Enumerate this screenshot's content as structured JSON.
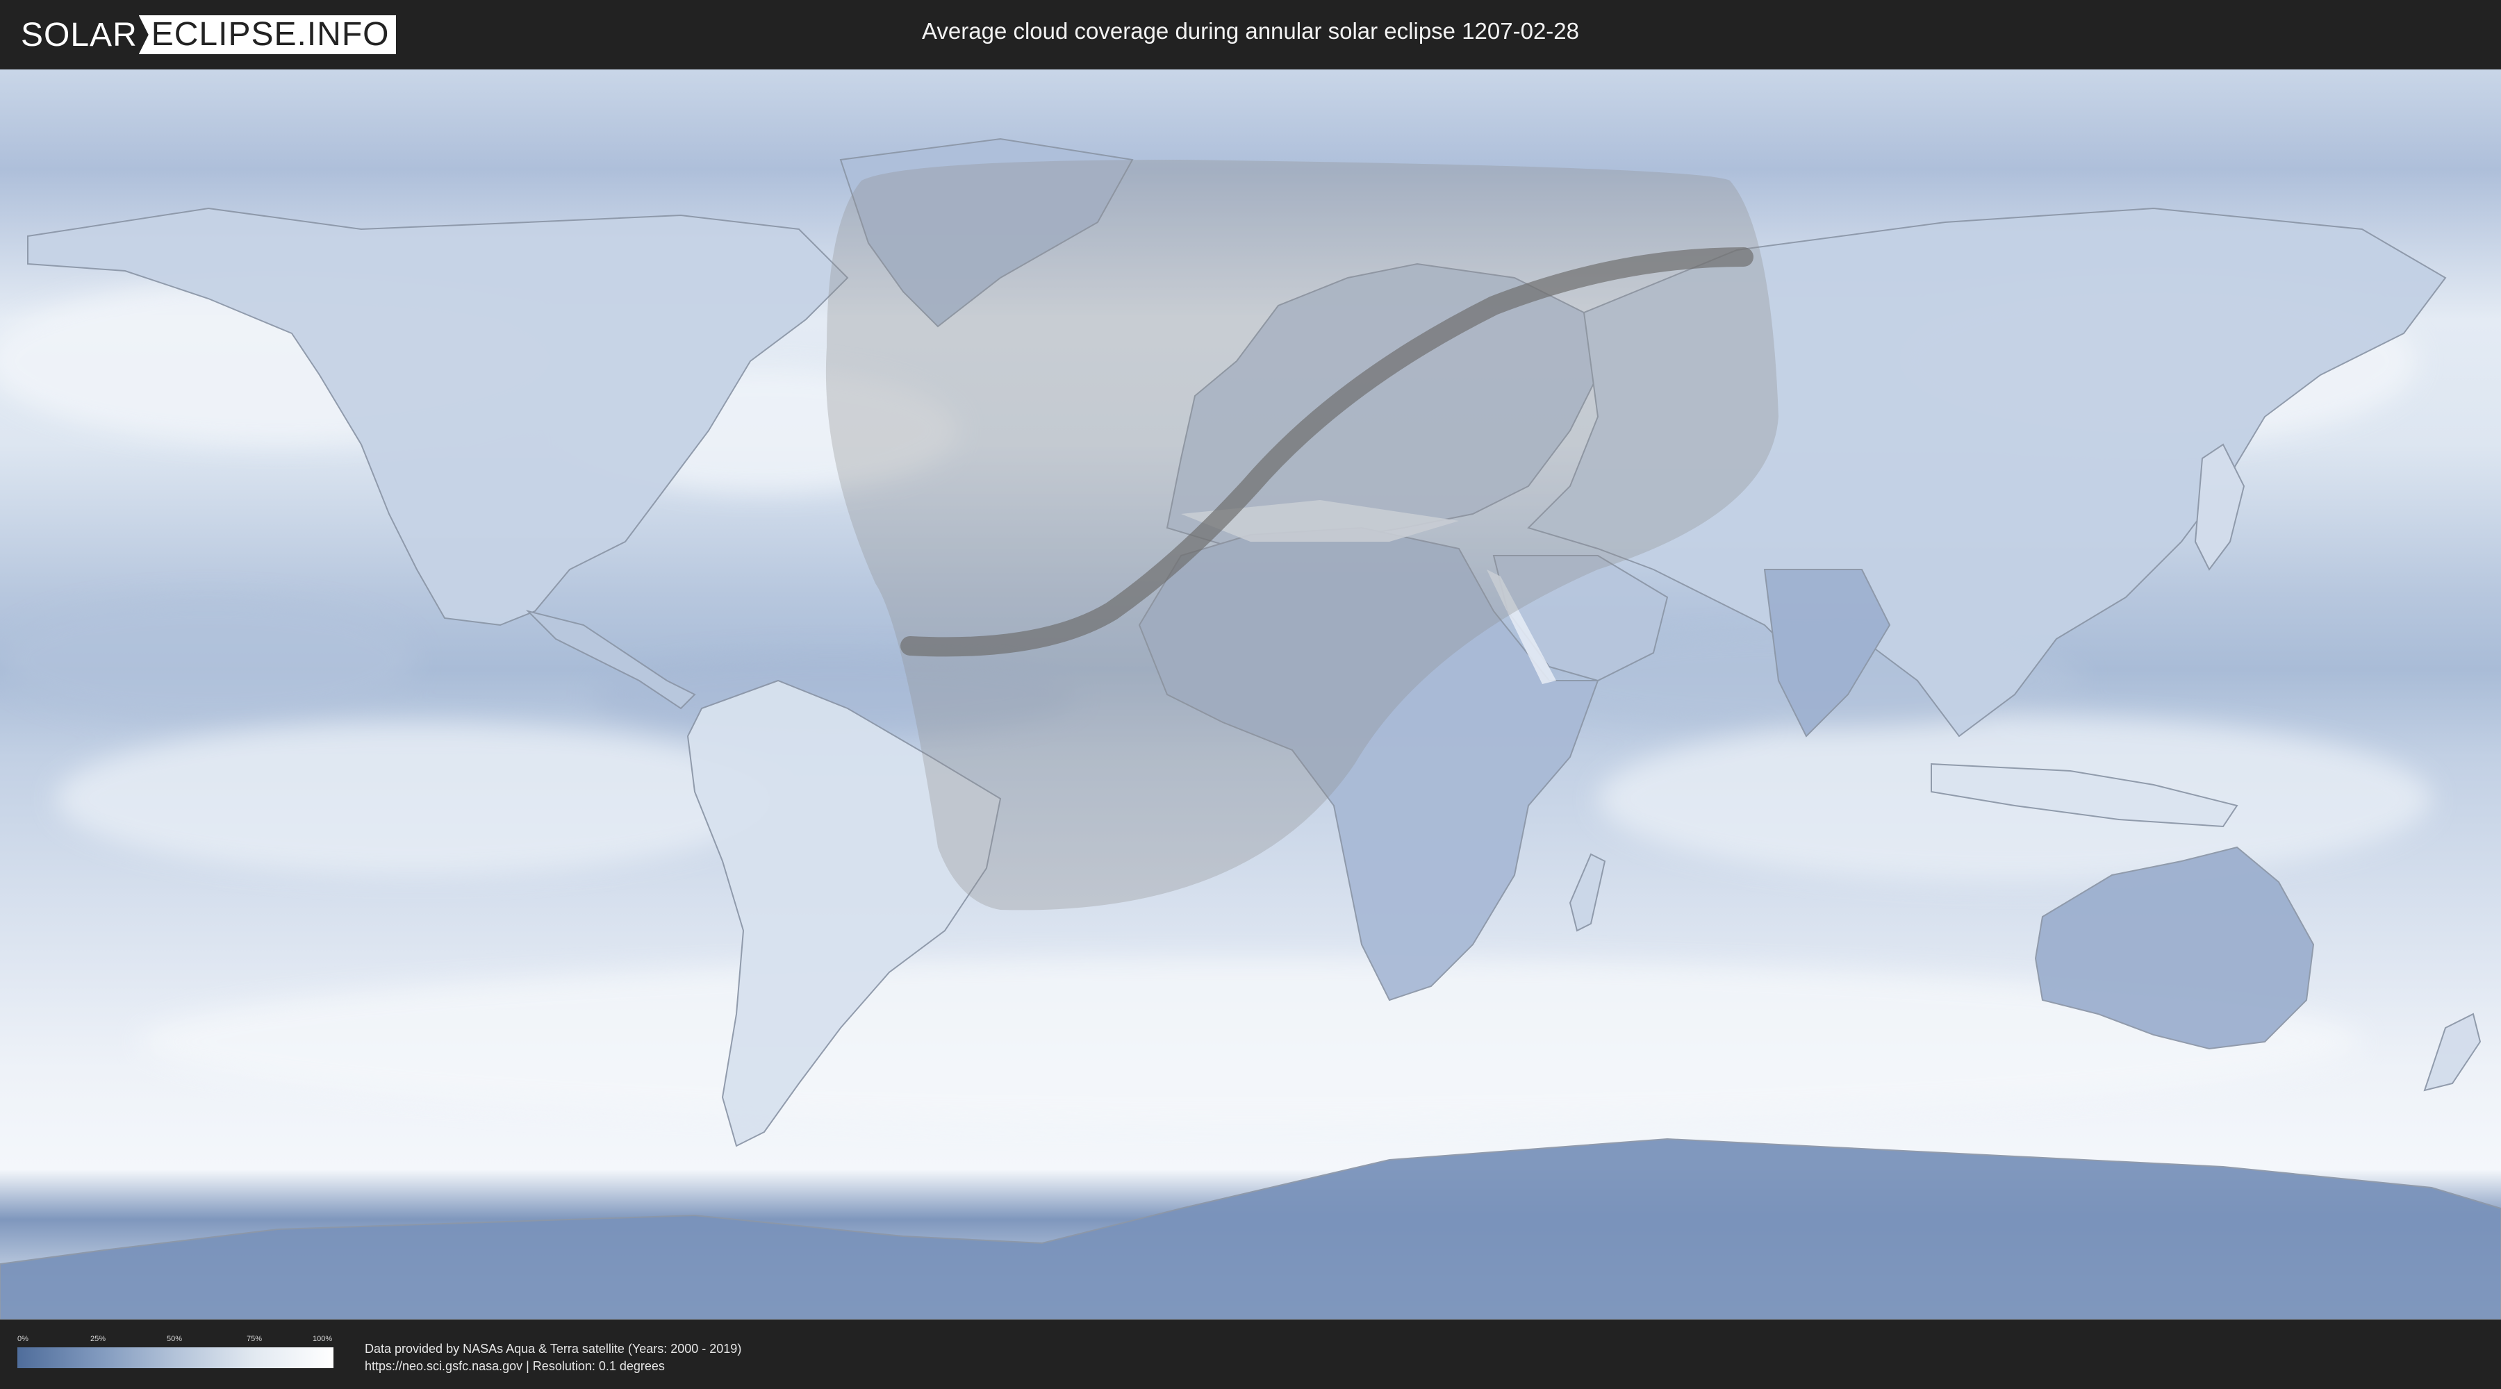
{
  "header": {
    "logo_left": "SOLAR",
    "logo_right": "ECLIPSE.INFO",
    "title": "Average cloud coverage during annular solar eclipse 1207-02-28"
  },
  "legend": {
    "ticks": [
      "0%",
      "25%",
      "50%",
      "75%",
      "100%"
    ],
    "colors": [
      "#4f6d9b",
      "#7f98bd",
      "#b3c3d9",
      "#e2e9f1",
      "#ffffff"
    ]
  },
  "footer": {
    "credit_line1": "Data provided by NASAs Aqua & Terra satellite (Years: 2000 - 2019)",
    "credit_line2": "https://neo.sci.gsfc.nasa.gov | Resolution: 0.1 degrees"
  },
  "map": {
    "projection": "equirectangular",
    "ocean_color": "#dfe7f2",
    "cloud_low_color": "#5a78a8",
    "eclipse_zone_color": "#9a9a9a",
    "central_path_color": "#6f6f6f"
  }
}
